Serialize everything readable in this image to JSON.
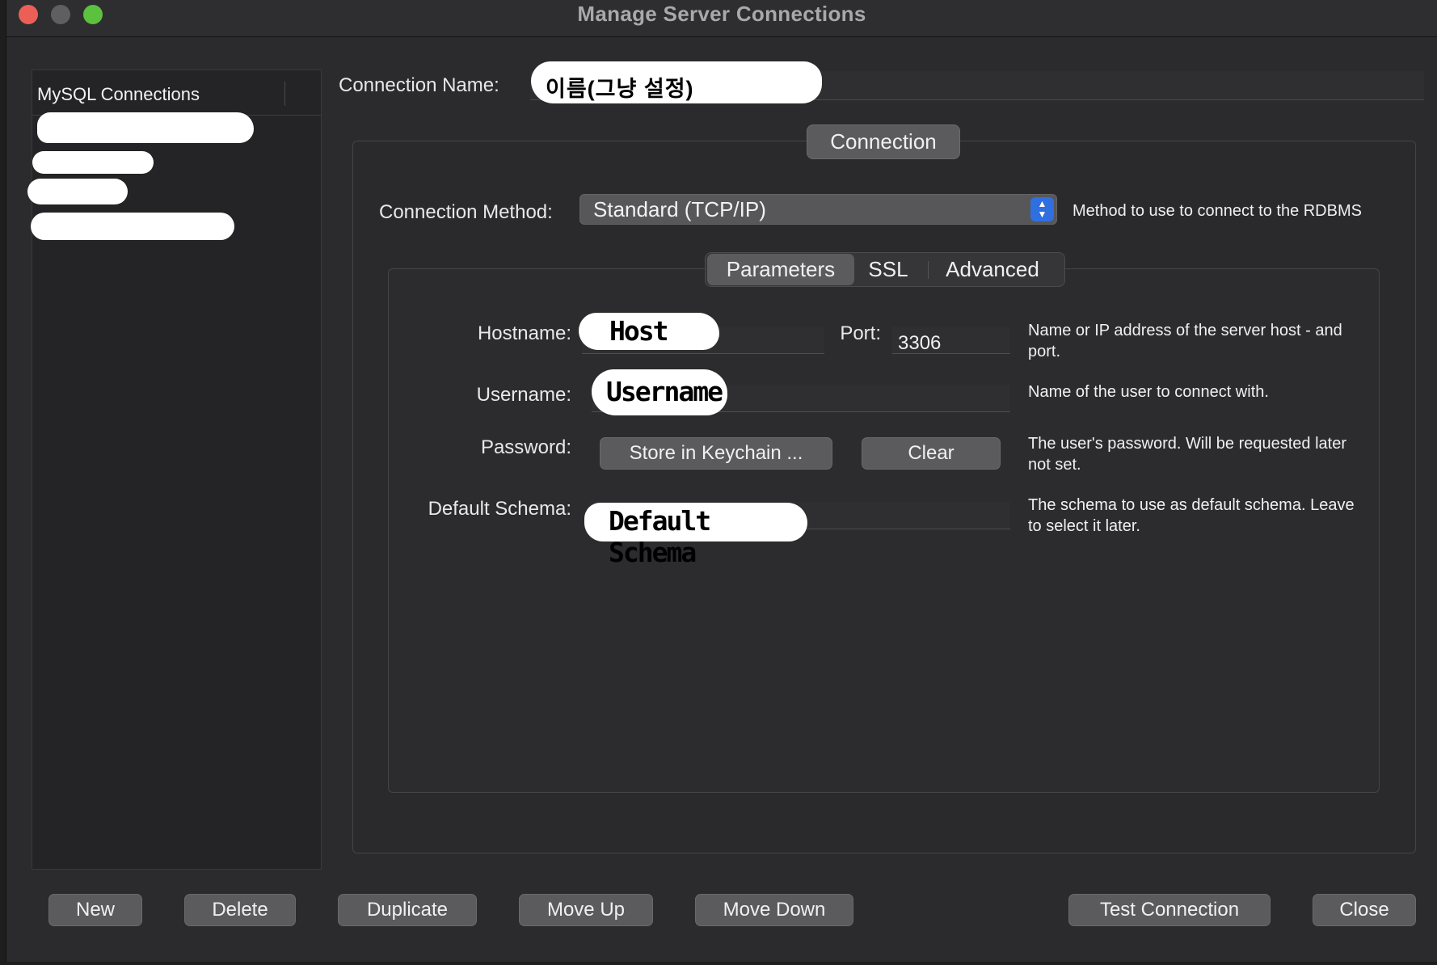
{
  "window": {
    "title": "Manage Server Connections"
  },
  "sidebar": {
    "header": "MySQL Connections"
  },
  "connection_name": {
    "label": "Connection Name:",
    "value": "이름(그냥 설정)"
  },
  "group": {
    "tab": "Connection"
  },
  "method": {
    "label": "Connection Method:",
    "value": "Standard (TCP/IP)",
    "description": "Method to use to connect to the RDBMS"
  },
  "tabs": {
    "parameters": "Parameters",
    "ssl": "SSL",
    "advanced": "Advanced"
  },
  "params": {
    "hostname": {
      "label": "Hostname:",
      "value": "Host",
      "description_1": "Name or IP address of the server host - and",
      "description_2": "port."
    },
    "port": {
      "label": "Port:",
      "value": "3306"
    },
    "username": {
      "label": "Username:",
      "value": "Username",
      "description": "Name of the user to connect with."
    },
    "password": {
      "label": "Password:",
      "store_button": "Store in Keychain ...",
      "clear_button": "Clear",
      "description_1": "The user's password. Will be requested later",
      "description_2": "not set."
    },
    "schema": {
      "label": "Default Schema:",
      "value": "Default  Schema",
      "description_1": "The schema to use as default schema. Leave",
      "description_2": "to select it later."
    }
  },
  "buttons": {
    "new": "New",
    "delete": "Delete",
    "duplicate": "Duplicate",
    "move_up": "Move Up",
    "move_down": "Move Down",
    "test": "Test Connection",
    "close": "Close"
  },
  "colors": {
    "accent": "#2f6fe0",
    "window_bg": "#2b2b2d",
    "close": "#ec5f57",
    "maximize": "#5cc13e"
  }
}
